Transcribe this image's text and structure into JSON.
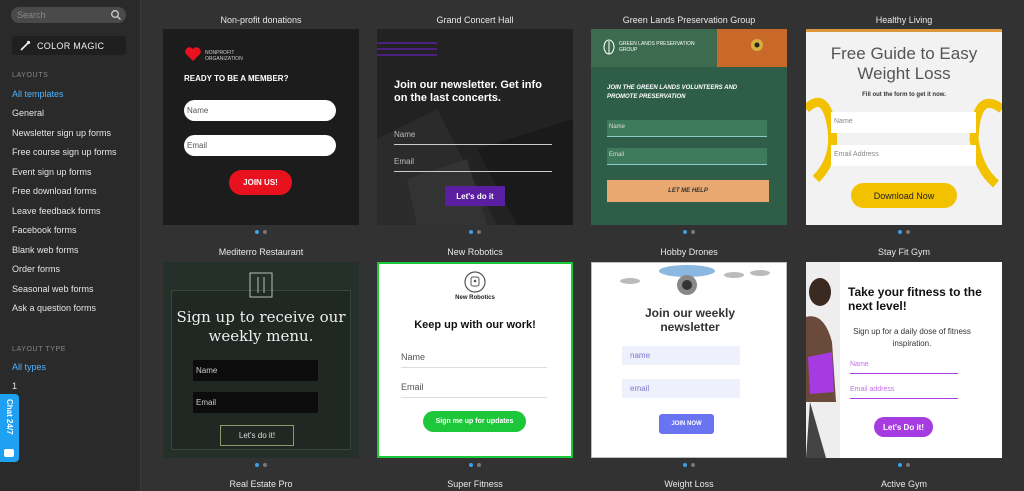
{
  "sidebar": {
    "search_placeholder": "Search",
    "color_magic": "COLOR MAGIC",
    "layouts_heading": "LAYOUTS",
    "layouts": [
      {
        "label": "All templates",
        "active": true
      },
      {
        "label": "General"
      },
      {
        "label": "Newsletter sign up forms"
      },
      {
        "label": "Free course sign up forms"
      },
      {
        "label": "Event sign up forms"
      },
      {
        "label": "Free download forms"
      },
      {
        "label": "Leave feedback forms"
      },
      {
        "label": "Facebook forms"
      },
      {
        "label": "Blank web forms"
      },
      {
        "label": "Order forms"
      },
      {
        "label": "Seasonal web forms"
      },
      {
        "label": "Ask a question forms"
      }
    ],
    "layout_type_heading": "LAYOUT TYPE",
    "types": [
      {
        "label": "All types",
        "active": true
      },
      {
        "label": "1"
      }
    ],
    "chat": "Chat 24/7"
  },
  "templates": [
    {
      "title": "Non-profit donations",
      "org": "NONPROFIT ORGANIZATION",
      "heading": "READY TO BE A MEMBER?",
      "field1": "Name",
      "field2": "Email",
      "button": "JOIN US!"
    },
    {
      "title": "Grand Concert Hall",
      "heading": "Join our newsletter. Get info on the last concerts.",
      "field1": "Name",
      "field2": "Email",
      "button": "Let's do it"
    },
    {
      "title": "Green Lands Preservation Group",
      "org": "GREEN LANDS PRESERVATION GROUP",
      "heading": "JOIN THE GREEN LANDS VOLUNTEERS AND PROMOTE PRESERVATION",
      "field1": "Name",
      "field2": "Email",
      "button": "LET ME HELP"
    },
    {
      "title": "Healthy Living",
      "heading": "Free Guide to Easy Weight Loss",
      "sub": "Fill out the form to get it now.",
      "field1": "Name",
      "field2": "Email Address",
      "button": "Download Now"
    },
    {
      "title": "Mediterro Restaurant",
      "heading": "Sign up to receive our weekly menu.",
      "field1": "Name",
      "field2": "Email",
      "button": "Let's do it!"
    },
    {
      "title": "New Robotics",
      "org": "New Robotics",
      "heading": "Keep up with our work!",
      "field1": "Name",
      "field2": "Email",
      "button": "Sign me up for updates"
    },
    {
      "title": "Hobby Drones",
      "heading": "Join our weekly newsletter",
      "field1": "name",
      "field2": "email",
      "button": "JOIN NOW"
    },
    {
      "title": "Stay Fit Gym",
      "heading": "Take your fitness to the next level!",
      "sub": "Sign up for a daily dose of fitness inspiration.",
      "field1": "Name",
      "field2": "Email address",
      "button": "Let's Do it!"
    }
  ],
  "bottom_titles": [
    "Real Estate Pro",
    "Super Fitness",
    "Weight Loss",
    "Active Gym"
  ],
  "colors": {
    "accent_blue": "#4fb3ff",
    "nonprofit_red": "#e8121e",
    "concert_purple": "#5a1fa0",
    "green_lands": "#2e5d48",
    "healthy_yellow": "#f2c200",
    "robotics_green": "#1dc73a",
    "drones_blue": "#6a74f0",
    "gym_purple": "#a53be0"
  }
}
